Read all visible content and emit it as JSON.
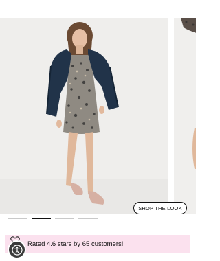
{
  "carousel": {
    "cta_label": "SHOP THE LOOK",
    "slide_count": 4,
    "active_slide": 2
  },
  "rating": {
    "text": "Rated 4.6 stars by 65 customers!"
  },
  "colors": {
    "banner_bg": "#fbe1ee",
    "active_dot": "#111111",
    "inactive_dot": "#c9c9c9"
  },
  "icons": {
    "heart": "heart-icon",
    "accessibility": "accessibility-icon"
  }
}
